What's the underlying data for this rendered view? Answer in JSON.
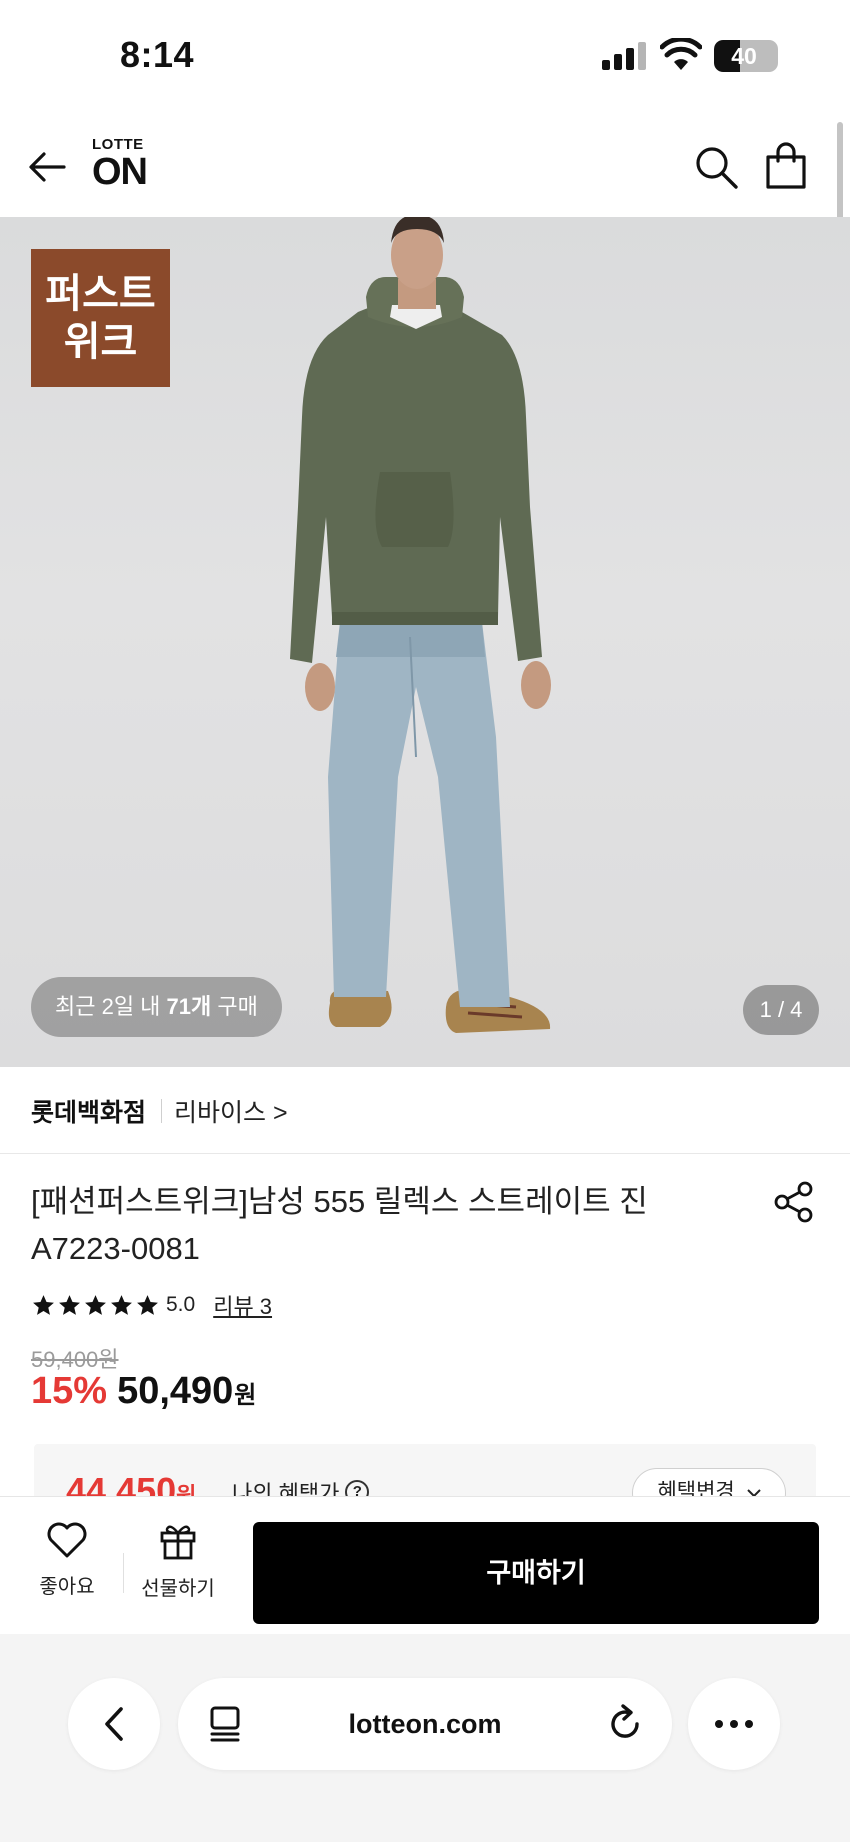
{
  "status_bar": {
    "time": "8:14",
    "battery": "40",
    "battery_level": 0.4
  },
  "header": {
    "logo_top": "LOTTE",
    "logo_main": "ON"
  },
  "hero": {
    "badge_line1": "퍼스트",
    "badge_line2": "위크",
    "purchase_prefix": "최근 2일 내 ",
    "purchase_count": "71개",
    "purchase_suffix": " 구매",
    "page_indicator": "1 / 4"
  },
  "store": {
    "name": "롯데백화점",
    "brand": "리바이스 >"
  },
  "product": {
    "title": "[패션퍼스트위크]남성 555 릴렉스 스트레이트 진 A7223-0081",
    "rating_value": "5.0",
    "star_count": 5,
    "review_link": "리뷰 3",
    "original_price": "59,400원",
    "discount": "15%",
    "sale_price": "50,490",
    "sale_currency": "원"
  },
  "benefit": {
    "price": "44,450",
    "currency": "원",
    "label": "나의 혜택가",
    "help": "?",
    "change_button": "혜택변경"
  },
  "actions": {
    "like_label": "좋아요",
    "gift_label": "선물하기",
    "buy_label": "구매하기"
  },
  "browser": {
    "url": "lotteon.com"
  },
  "colors": {
    "accent_red": "#e53935",
    "badge_brown": "#8b4a2b",
    "buy_button": "#000000"
  }
}
